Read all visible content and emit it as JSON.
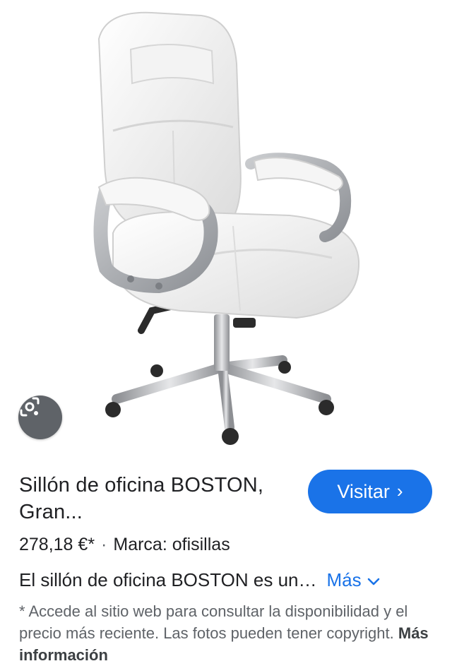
{
  "product": {
    "title": "Sillón de oficina BOSTON, Gran...",
    "price": "278,18 €*",
    "separator": "·",
    "brand": "Marca: ofisillas",
    "description": "El sillón de oficina BOSTON es un…",
    "more_label": "Más"
  },
  "visit_button": {
    "label": "Visitar",
    "chevron": "›"
  },
  "lens_button": {
    "icon": "lens-icon"
  },
  "disclaimer": {
    "text": "* Accede al sitio web para consultar la disponibilidad y el precio más reciente. Las fotos pueden tener copyright.",
    "link_label": "Más información"
  },
  "colors": {
    "accent": "#1a73e8",
    "text": "#202124",
    "secondary": "#5f6368"
  }
}
